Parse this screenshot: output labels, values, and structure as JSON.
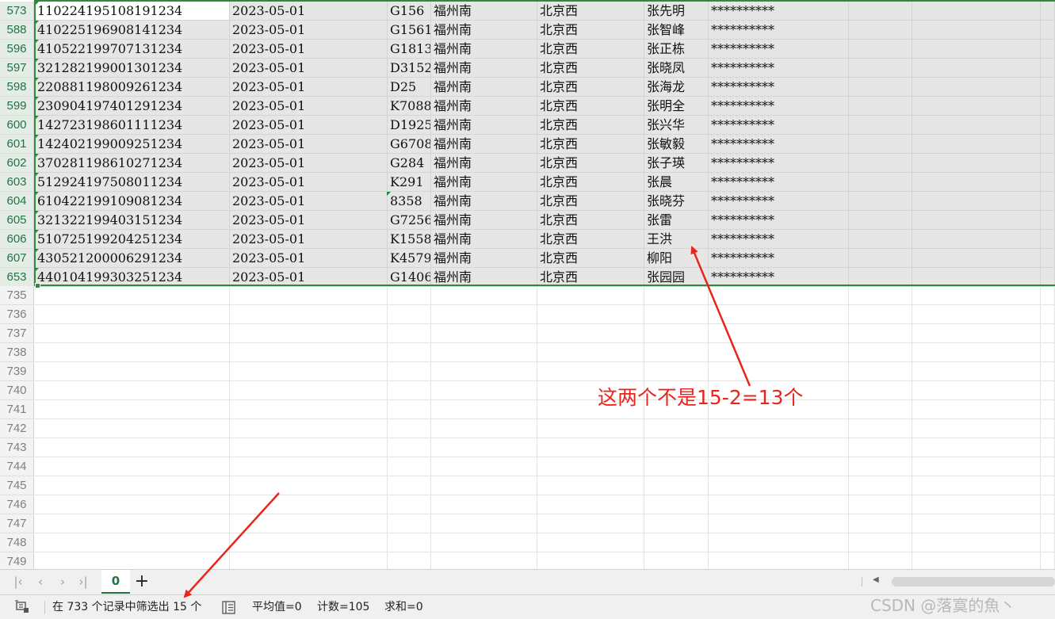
{
  "sheet": {
    "filtered_rows": [
      {
        "row": "573",
        "id": "110224195108191234",
        "date": "2023-05-01",
        "train": "G156",
        "from": "福州南",
        "to": "北京西",
        "name": "张先明",
        "mask": "**********"
      },
      {
        "row": "588",
        "id": "410225196908141234",
        "date": "2023-05-01",
        "train": "G1561",
        "from": "福州南",
        "to": "北京西",
        "name": "张智峰",
        "mask": "**********"
      },
      {
        "row": "596",
        "id": "410522199707131234",
        "date": "2023-05-01",
        "train": "G1813",
        "from": "福州南",
        "to": "北京西",
        "name": "张正栋",
        "mask": "**********"
      },
      {
        "row": "597",
        "id": "321282199001301234",
        "date": "2023-05-01",
        "train": "D3152",
        "from": "福州南",
        "to": "北京西",
        "name": "张晓凤",
        "mask": "**********"
      },
      {
        "row": "598",
        "id": "220881198009261234",
        "date": "2023-05-01",
        "train": "D25",
        "from": "福州南",
        "to": "北京西",
        "name": "张海龙",
        "mask": "**********"
      },
      {
        "row": "599",
        "id": "230904197401291234",
        "date": "2023-05-01",
        "train": "K7088",
        "from": "福州南",
        "to": "北京西",
        "name": "张明全",
        "mask": "**********"
      },
      {
        "row": "600",
        "id": "142723198601111234",
        "date": "2023-05-01",
        "train": "D1925",
        "from": "福州南",
        "to": "北京西",
        "name": "张兴华",
        "mask": "**********"
      },
      {
        "row": "601",
        "id": "142402199009251234",
        "date": "2023-05-01",
        "train": "G6708",
        "from": "福州南",
        "to": "北京西",
        "name": "张敏毅",
        "mask": "**********"
      },
      {
        "row": "602",
        "id": "370281198610271234",
        "date": "2023-05-01",
        "train": "G284",
        "from": "福州南",
        "to": "北京西",
        "name": "张子瑛",
        "mask": "**********"
      },
      {
        "row": "603",
        "id": "512924197508011234",
        "date": "2023-05-01",
        "train": "K291",
        "from": "福州南",
        "to": "北京西",
        "name": "张晨",
        "mask": "**********"
      },
      {
        "row": "604",
        "id": "610422199109081234",
        "date": "2023-05-01",
        "train": "8358",
        "from": "福州南",
        "to": "北京西",
        "name": "张晓芬",
        "mask": "**********"
      },
      {
        "row": "605",
        "id": "321322199403151234",
        "date": "2023-05-01",
        "train": "G7256",
        "from": "福州南",
        "to": "北京西",
        "name": "张雷",
        "mask": "**********"
      },
      {
        "row": "606",
        "id": "510725199204251234",
        "date": "2023-05-01",
        "train": "K1558",
        "from": "福州南",
        "to": "北京西",
        "name": "王洪",
        "mask": "**********"
      },
      {
        "row": "607",
        "id": "430521200006291234",
        "date": "2023-05-01",
        "train": "K4579",
        "from": "福州南",
        "to": "北京西",
        "name": "柳阳",
        "mask": "**********"
      },
      {
        "row": "653",
        "id": "440104199303251234",
        "date": "2023-05-01",
        "train": "G1406",
        "from": "福州南",
        "to": "北京西",
        "name": "张园园",
        "mask": "**********"
      }
    ],
    "empty_rows": [
      "735",
      "736",
      "737",
      "738",
      "739",
      "740",
      "741",
      "742",
      "743",
      "744",
      "745",
      "746",
      "747",
      "748",
      "749"
    ]
  },
  "tabbar": {
    "first_icon": "first-sheet-icon",
    "prev_icon": "prev-sheet-icon",
    "next_icon": "next-sheet-icon",
    "last_icon": "last-sheet-icon",
    "sheet_tab_label": "0",
    "add_sheet_label": "+"
  },
  "statusbar": {
    "filter_info": "在 733 个记录中筛选出 15 个",
    "average": "平均值=0",
    "count": "计数=105",
    "sum": "求和=0"
  },
  "annotation": {
    "text": "这两个不是15-2=13个",
    "color": "#e8251d"
  },
  "watermark": "CSDN @落寞的魚丶",
  "colors": {
    "accent": "#217346",
    "selection_border": "#2e8b3a",
    "annotation_red": "#e8251d"
  }
}
